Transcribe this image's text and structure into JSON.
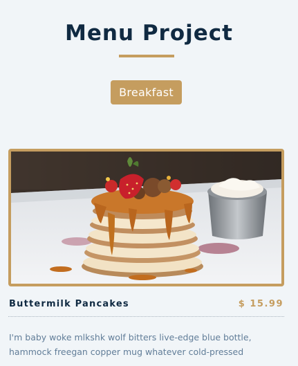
{
  "page": {
    "title": "Menu Project"
  },
  "filters": {
    "active_label": "Breakfast"
  },
  "menu_item": {
    "image_alt": "pancake-stack-photo",
    "title": "Buttermilk Pancakes",
    "price": "$ 15.99",
    "description": "I'm baby woke mlkshk wolf bitters live-edge blue bottle, hammock freegan copper mug whatever cold-pressed"
  },
  "colors": {
    "background": "#f1f5f8",
    "accent": "#c59d5f",
    "heading": "#102a42",
    "body_text": "#617d98"
  }
}
